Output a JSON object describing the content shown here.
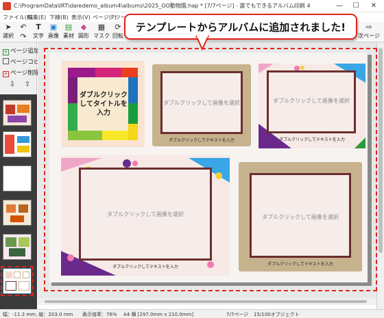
{
  "window": {
    "title": "C:\\ProgramData\\IRT\\daredemo_album4\\albums\\2025_OO動物園.hap * [7/7ページ] - 誰でもできるアルバム印刷 4",
    "minimize": "—",
    "maximize": "☐",
    "close": "✕"
  },
  "menu": [
    "ファイル(F)",
    "編集(E)",
    "下線(B)",
    "表示(V)",
    "ページ(P)",
    "ツール"
  ],
  "toolbar": {
    "tools": [
      {
        "label": "選択",
        "icon": "cursor-icon"
      },
      {
        "label": "文字",
        "icon": "text-icon"
      },
      {
        "label": "画像",
        "icon": "image-icon"
      },
      {
        "label": "素材",
        "icon": "material-icon"
      },
      {
        "label": "図形",
        "icon": "shape-icon"
      },
      {
        "label": "マスク",
        "icon": "mask-icon"
      },
      {
        "label": "回転",
        "icon": "rotate-icon"
      }
    ],
    "next_page": "次ページ"
  },
  "callout": {
    "text": "テンプレートからアルバムに追加されました!"
  },
  "sidebar": {
    "add_page": "ページ追加",
    "copy_page": "ページコピー",
    "delete_page": "ページ削除"
  },
  "page": {
    "title_box": "ダブルクリックしてタイトルを入力",
    "photo_placeholder": "ダブルクリックして画像を選択",
    "caption_placeholder": "ダブルクリックしてテキストを入力"
  },
  "status": {
    "size": "幅：-11.3 mm, 縦：203.0 mm",
    "zoom": "表示倍率：76%",
    "paper": "A4 横 [297.0mm x 210.0mm]",
    "page": "7/7ページ",
    "objects": "15/100オブジェクト"
  },
  "colors": {
    "accent_red": "#e2231a",
    "frame_brown": "#6b2e2e",
    "frame_tan": "#c7b28e"
  }
}
